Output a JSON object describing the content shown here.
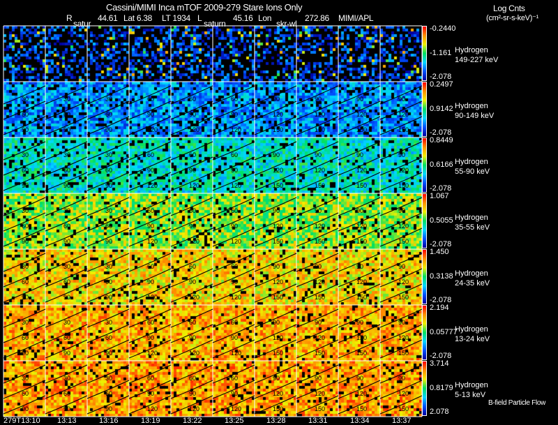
{
  "header": {
    "title": "Cassini/MIMI Inca mTOF  2009-279   Stare   Ions Only",
    "ephemeris": {
      "r_label": "R",
      "r": "44.61",
      "lat": "Lat 6.38",
      "lt": "LT 1934",
      "l_label": "L",
      "l": "45.16",
      "lon_label": "Lon",
      "lon": "272.86",
      "source": "MIMI/APL"
    },
    "markers": [
      "satur",
      "saturn",
      "skr-wl"
    ]
  },
  "units": {
    "line1": "Log Cnts",
    "line2": "(cm²-sr-s-keV)⁻¹"
  },
  "footer_note": "B-field Particle Flow",
  "chart_data": {
    "type": "heatmap",
    "x_ticks": [
      "279T13:10",
      "13:13",
      "13:16",
      "13:19",
      "13:22",
      "13:25",
      "13:28",
      "13:31",
      "13:34",
      "13:37"
    ],
    "contour_levels": [
      "30",
      "60",
      "90",
      "120",
      "150"
    ],
    "colormap": "rainbow",
    "rows": [
      {
        "species": "Hydrogen",
        "energy": "149-227 keV",
        "cb_max": "-0.2440",
        "cb_mid": "-1.161",
        "cb_min": "-2.078"
      },
      {
        "species": "Hydrogen",
        "energy": "90-149 keV",
        "cb_max": "0.2497",
        "cb_mid": "0.9142",
        "cb_min": "-2.078"
      },
      {
        "species": "Hydrogen",
        "energy": "55-90 keV",
        "cb_max": "0.8449",
        "cb_mid": "0.6166",
        "cb_min": "-2.078"
      },
      {
        "species": "Hydrogen",
        "energy": "35-55 keV",
        "cb_max": "1.067",
        "cb_mid": "0.5055",
        "cb_min": "-2.078"
      },
      {
        "species": "Hydrogen",
        "energy": "24-35 keV",
        "cb_max": "1.450",
        "cb_mid": "0.3138",
        "cb_min": "-2.078"
      },
      {
        "species": "Hydrogen",
        "energy": "13-24 keV",
        "cb_max": "2.194",
        "cb_mid": "0.05777",
        "cb_min": "-2.078"
      },
      {
        "species": "Hydrogen",
        "energy": "5-13 keV",
        "cb_max": "3.714",
        "cb_mid": "0.8179",
        "cb_min": "2.078"
      }
    ]
  }
}
